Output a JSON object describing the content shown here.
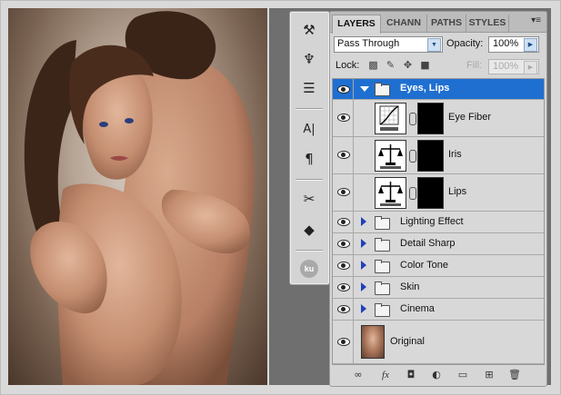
{
  "tools": [
    {
      "name": "brush-preset-icon",
      "glyph": "⚒"
    },
    {
      "name": "clone-source-icon",
      "glyph": "♆"
    },
    {
      "name": "tool-presets-icon",
      "glyph": "☰"
    },
    {
      "name": "character-icon",
      "glyph": "A|"
    },
    {
      "name": "paragraph-icon",
      "glyph": "¶"
    },
    {
      "name": "tools-icon",
      "glyph": "✂"
    },
    {
      "name": "3d-icon",
      "glyph": "◆"
    }
  ],
  "ku_badge": "ku",
  "tabs": [
    {
      "label": "LAYERS",
      "active": true
    },
    {
      "label": "CHANN",
      "active": false
    },
    {
      "label": "PATHS",
      "active": false
    },
    {
      "label": "STYLES",
      "active": false
    }
  ],
  "panel_menu_icon": "▾≡",
  "blend_mode": "Pass Through",
  "opacity_label": "Opacity:",
  "opacity_value": "100%",
  "lock_label": "Lock:",
  "fill_label": "Fill:",
  "fill_value": "100%",
  "layers": {
    "group_eyes": {
      "name": "Eyes, Lips",
      "expanded": true,
      "selected": true
    },
    "adj_eye_fiber": {
      "name": "Eye Fiber",
      "type": "curves"
    },
    "adj_iris": {
      "name": "Iris",
      "type": "color-balance"
    },
    "adj_lips": {
      "name": "Lips",
      "type": "color-balance"
    },
    "groups": [
      {
        "name": "Lighting Effect"
      },
      {
        "name": "Detail Sharp"
      },
      {
        "name": "Color Tone"
      },
      {
        "name": "Skin"
      },
      {
        "name": "Cinema"
      }
    ],
    "original": {
      "name": "Original"
    }
  },
  "bottom_icons": [
    "∞",
    "fx",
    "◘",
    "◐",
    "▭",
    "⊞",
    "🗑"
  ]
}
